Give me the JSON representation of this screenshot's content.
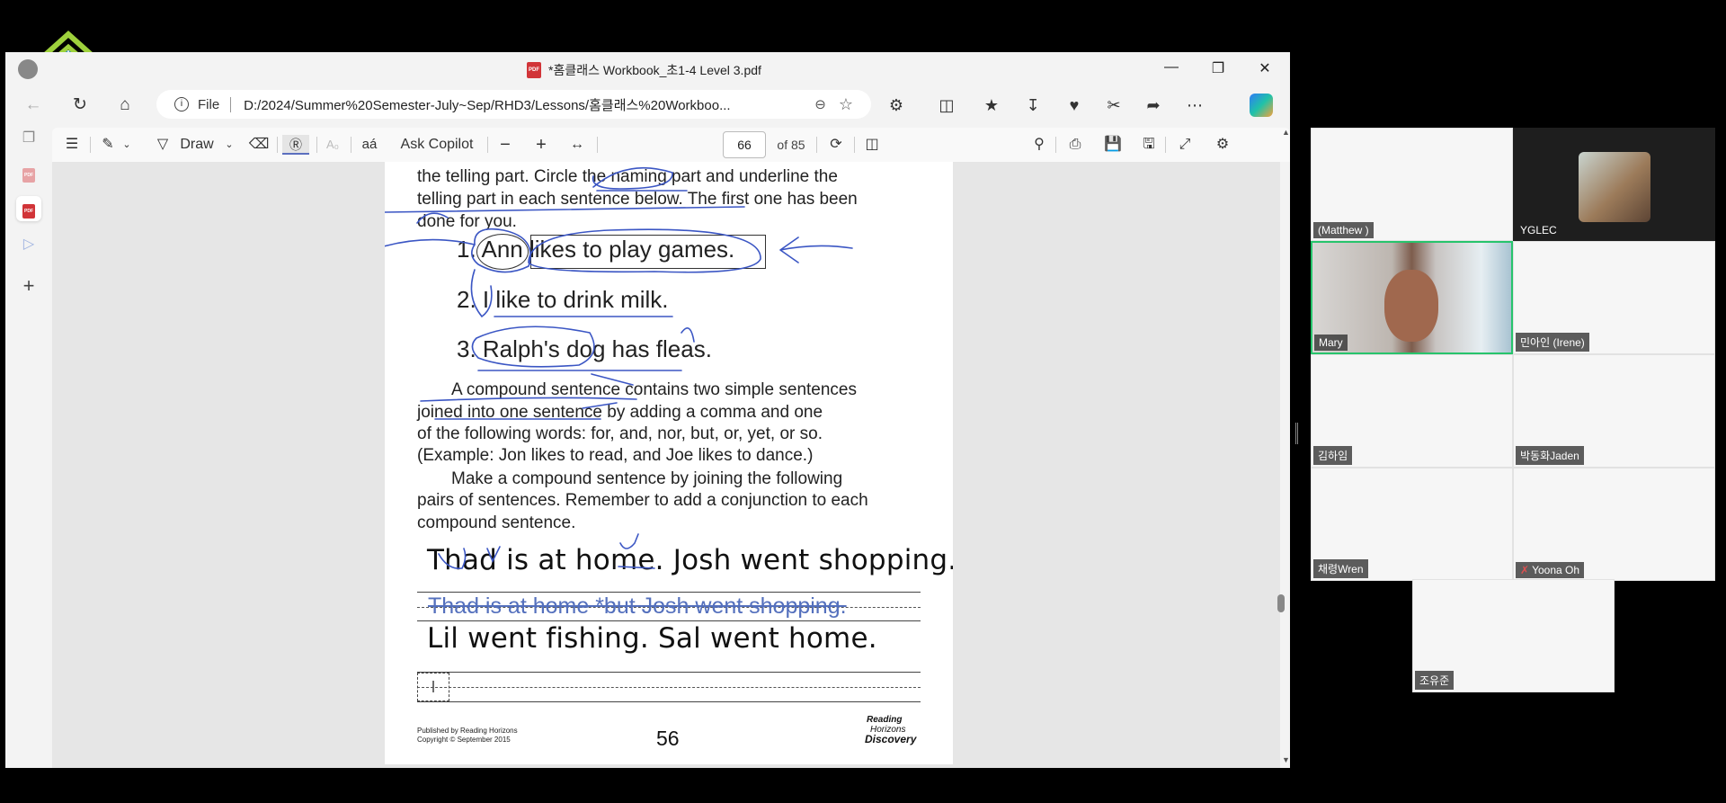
{
  "browser": {
    "tab_title": "*홈클래스 Workbook_초1-4 Level 3.pdf",
    "address": {
      "scheme_label": "File",
      "url": "D:/2024/Summer%20Semester-July~Sep/RHD3/Lessons/홈클래스%20Workboo..."
    }
  },
  "pdf_toolbar": {
    "draw_label": "Draw",
    "ask_copilot_label": "Ask Copilot",
    "current_page": "66",
    "total_pages": "of 85"
  },
  "page": {
    "intro_lines": [
      "the telling part. Circle the naming part and underline the",
      "telling part in each sentence below. The first one has been",
      "done for you."
    ],
    "examples": [
      "1. Ann likes to play games.",
      "2. I like to drink milk.",
      "3. Ralph's dog has fleas."
    ],
    "compound_lines": [
      "A compound sentence contains two simple sentences",
      "joined into one sentence by adding a comma and one",
      "of the following words: for, and, nor, but, or, yet, or so.",
      "(Example: Jon likes to read, and Joe likes to dance.)"
    ],
    "instruction_lines": [
      "Make a compound sentence by joining the following",
      "pairs of sentences. Remember to add a conjunction to each",
      "compound sentence."
    ],
    "exercise1": "Thad is at home. Josh went shopping.",
    "typed_answer1": "Thad is at home *but Josh went shopping.",
    "exercise2": "Lil went fishing. Sal went home.",
    "publisher_line1": "Published by Reading Horizons",
    "publisher_line2": "Copyright © September 2015",
    "page_number": "56",
    "brand_line1": "Reading",
    "brand_line2": "Horizons",
    "brand_line3": "Discovery"
  },
  "participants": [
    {
      "name": "(Matthew )"
    },
    {
      "name": "YGLEC"
    },
    {
      "name": "Mary"
    },
    {
      "name": "민아인 (Irene)"
    },
    {
      "name": "김하임"
    },
    {
      "name": "박동화Jaden"
    },
    {
      "name": "채령Wren"
    },
    {
      "name": "Yoona Oh"
    },
    {
      "name": "조유준"
    }
  ],
  "colors": {
    "ink": "#3b56c4",
    "typed_text": "#5470bd",
    "speaking_border": "#27c46c",
    "logo_green": "#9ed13c"
  }
}
